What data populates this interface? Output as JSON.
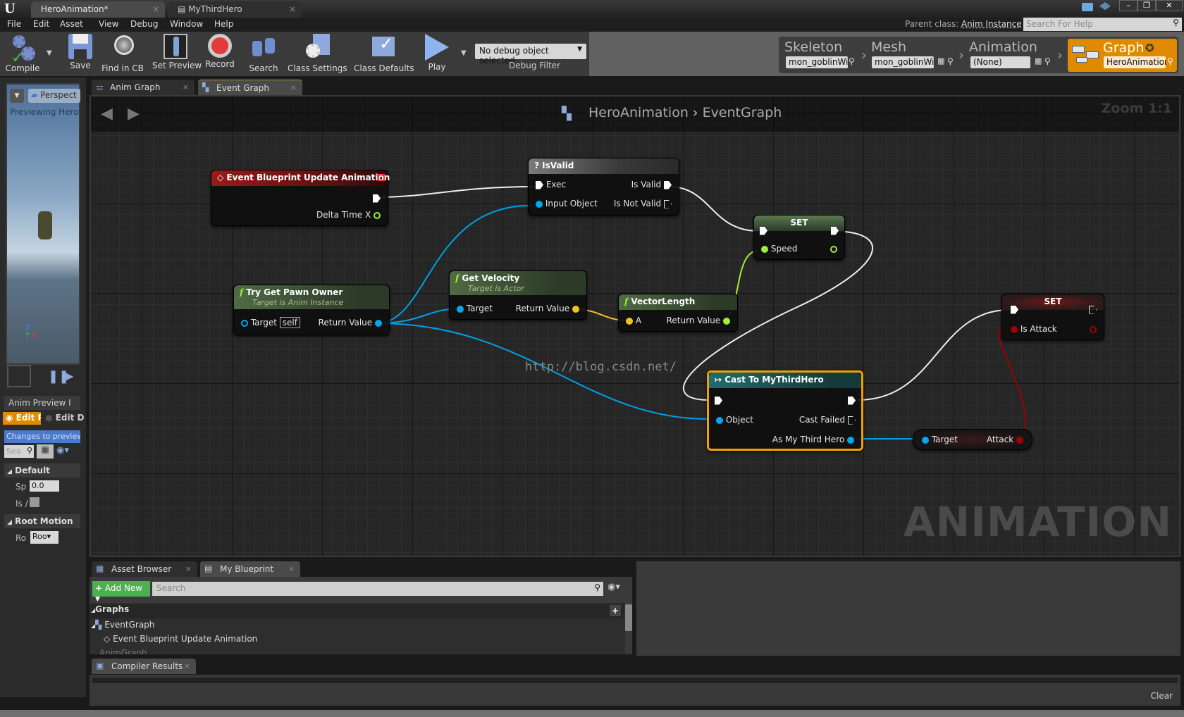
{
  "titlebar": {
    "tabs": [
      {
        "label": "HeroAnimation*",
        "active": true
      },
      {
        "label": "MyThirdHero",
        "active": false
      }
    ],
    "window_buttons": [
      "minimize",
      "restore",
      "close"
    ]
  },
  "menubar": {
    "items": [
      "File",
      "Edit",
      "Asset",
      "View",
      "Debug",
      "Window",
      "Help"
    ],
    "parent_class_label": "Parent class:",
    "parent_class_value": "Anim Instance",
    "help_search_placeholder": "Search For Help"
  },
  "toolbar": {
    "buttons": [
      {
        "label": "Compile",
        "icon": "compile-icon"
      },
      {
        "label": "Save",
        "icon": "save-icon"
      },
      {
        "label": "Find in CB",
        "icon": "find-icon"
      },
      {
        "label": "Set Preview",
        "icon": "preview-icon"
      },
      {
        "label": "Record",
        "icon": "record-icon"
      },
      {
        "label": "Search",
        "icon": "binoculars-icon"
      },
      {
        "label": "Class Settings",
        "icon": "gear-icon"
      },
      {
        "label": "Class Defaults",
        "icon": "defaults-icon"
      },
      {
        "label": "Play",
        "icon": "play-icon"
      }
    ],
    "debug_select": "No debug object selected",
    "debug_label": "Debug Filter"
  },
  "modes": {
    "skeleton": {
      "label": "Skeleton",
      "value": "mon_goblinWiz"
    },
    "mesh": {
      "label": "Mesh",
      "value": "mon_goblinWiz"
    },
    "animation": {
      "label": "Animation",
      "value": "(None)"
    },
    "graph": {
      "label": "Graph",
      "value": "HeroAnimation"
    }
  },
  "left_panel": {
    "view_mode": "Perspect",
    "previewing": "Previewing HeroAn",
    "anim_preview_tab": "Anim Preview I",
    "edit_preview": "Edit Pr",
    "edit_defaults": "Edit De",
    "changes_banner": "Changes to preview c",
    "search_placeholder": "Sea",
    "sections": [
      {
        "title": "Default",
        "rows": [
          {
            "label": "Sp",
            "value": "0.0"
          },
          {
            "label": "Is /",
            "value": ""
          }
        ]
      },
      {
        "title": "Root Motion",
        "rows": [
          {
            "label": "Ro",
            "value": "Roo"
          }
        ]
      }
    ]
  },
  "graph_tabs": [
    {
      "label": "Anim Graph",
      "active": false
    },
    {
      "label": "Event Graph",
      "active": true
    }
  ],
  "graph": {
    "breadcrumb": [
      "HeroAnimation",
      "EventGraph"
    ],
    "zoom": "Zoom 1:1",
    "watermark": "ANIMATION",
    "url_overlay": "http://blog.csdn.net/",
    "nodes": {
      "event": {
        "title": "Event Blueprint Update Animation",
        "pin": "Delta Time X"
      },
      "isvalid": {
        "title": "IsValid",
        "exec": "Exec",
        "input": "Input Object",
        "valid": "Is Valid",
        "notvalid": "Is Not Valid"
      },
      "set_speed": {
        "title": "SET",
        "pin": "Speed"
      },
      "pawn": {
        "title": "Try Get Pawn Owner",
        "subtitle": "Target is Anim Instance",
        "target": "Target",
        "self": "self",
        "ret": "Return Value"
      },
      "velocity": {
        "title": "Get Velocity",
        "subtitle": "Target is Actor",
        "target": "Target",
        "ret": "Return Value"
      },
      "veclen": {
        "title": "VectorLength",
        "a": "A",
        "ret": "Return Value"
      },
      "cast": {
        "title": "Cast To MyThirdHero",
        "object": "Object",
        "failed": "Cast Failed",
        "as": "As My Third Hero"
      },
      "set_attack": {
        "title": "SET",
        "pin": "Is Attack"
      },
      "get_attack": {
        "target": "Target",
        "attack": "Attack"
      }
    }
  },
  "bottom": {
    "tabs": [
      {
        "label": "Asset Browser"
      },
      {
        "label": "My Blueprint"
      }
    ],
    "add_new": "Add New",
    "search_placeholder": "Search",
    "tree": {
      "graphs": "Graphs",
      "event_graph": "EventGraph",
      "event_item": "Event Blueprint Update Animation",
      "anim_graph": "AnimGraph"
    },
    "compiler_tab": "Compiler Results",
    "clear": "Clear"
  },
  "colors": {
    "accent_orange": "#e08a00",
    "exec_white": "#ffffff",
    "object_blue": "#00a8f0",
    "float_green": "#9cf038",
    "vector_yellow": "#f4c020",
    "bool_red": "#a00000"
  }
}
